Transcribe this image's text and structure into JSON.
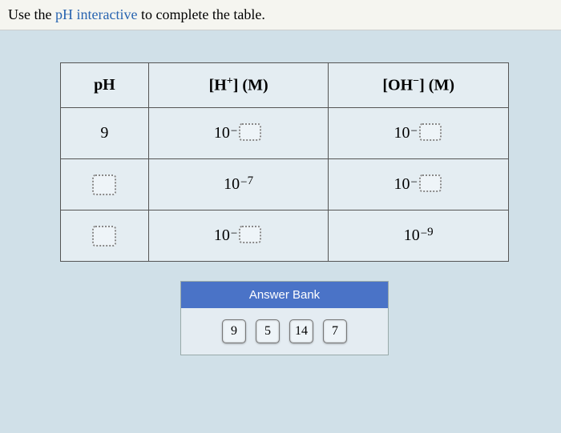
{
  "prompt": {
    "prefix": "Use the ",
    "link": "pH interactive",
    "suffix": " to complete the table."
  },
  "table": {
    "headers": {
      "ph": "pH",
      "h_label_html": "[H⁺] (M)",
      "oh_label_html": "[OH⁻] (M)"
    },
    "rows": [
      {
        "ph_value": "9",
        "ph_is_drop": false,
        "h_base": "10",
        "h_has_minus": true,
        "h_exp_is_drop": true,
        "h_exp_value": "",
        "oh_base": "10",
        "oh_has_minus": true,
        "oh_exp_is_drop": true,
        "oh_exp_value": ""
      },
      {
        "ph_value": "",
        "ph_is_drop": true,
        "h_base": "10",
        "h_has_minus": true,
        "h_exp_is_drop": false,
        "h_exp_value": "7",
        "oh_base": "10",
        "oh_has_minus": true,
        "oh_exp_is_drop": true,
        "oh_exp_value": ""
      },
      {
        "ph_value": "",
        "ph_is_drop": true,
        "h_base": "10",
        "h_has_minus": true,
        "h_exp_is_drop": true,
        "h_exp_value": "",
        "oh_base": "10",
        "oh_has_minus": true,
        "oh_exp_is_drop": false,
        "oh_exp_value": "9"
      }
    ]
  },
  "answer_bank": {
    "title": "Answer Bank",
    "items": [
      "9",
      "5",
      "14",
      "7"
    ]
  }
}
